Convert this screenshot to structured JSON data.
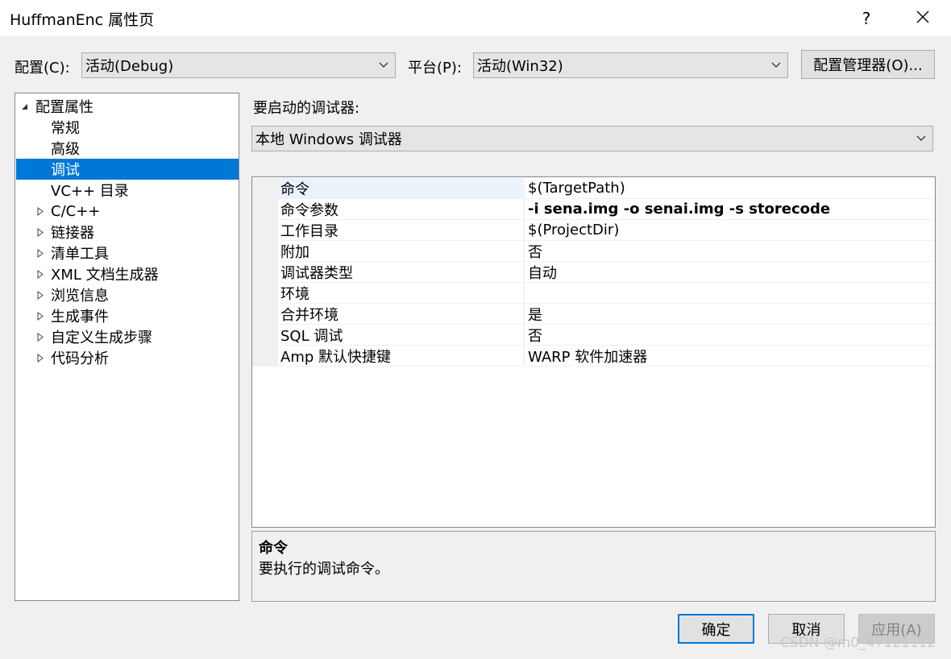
{
  "window": {
    "title": "HuffmanEnc 属性页",
    "help_label": "?",
    "close_label": "✕"
  },
  "config_bar": {
    "config_label": "配置(C):",
    "config_value": "活动(Debug)",
    "platform_label": "平台(P):",
    "platform_value": "活动(Win32)",
    "manager_button": "配置管理器(O)..."
  },
  "tree": {
    "root": "配置属性",
    "items": [
      {
        "label": "常规",
        "expandable": false
      },
      {
        "label": "高级",
        "expandable": false
      },
      {
        "label": "调试",
        "expandable": false,
        "selected": true
      },
      {
        "label": "VC++ 目录",
        "expandable": false
      },
      {
        "label": "C/C++",
        "expandable": true
      },
      {
        "label": "链接器",
        "expandable": true
      },
      {
        "label": "清单工具",
        "expandable": true
      },
      {
        "label": "XML 文档生成器",
        "expandable": true
      },
      {
        "label": "浏览信息",
        "expandable": true
      },
      {
        "label": "生成事件",
        "expandable": true
      },
      {
        "label": "自定义生成步骤",
        "expandable": true
      },
      {
        "label": "代码分析",
        "expandable": true
      }
    ]
  },
  "debugger": {
    "label": "要启动的调试器:",
    "value": "本地 Windows 调试器"
  },
  "properties": [
    {
      "name": "命令",
      "value": "$(TargetPath)",
      "bold": false
    },
    {
      "name": "命令参数",
      "value": "-i sena.img -o senai.img -s storecode",
      "bold": true
    },
    {
      "name": "工作目录",
      "value": "$(ProjectDir)",
      "bold": false
    },
    {
      "name": "附加",
      "value": "否",
      "bold": false
    },
    {
      "name": "调试器类型",
      "value": "自动",
      "bold": false
    },
    {
      "name": "环境",
      "value": "",
      "bold": false
    },
    {
      "name": "合并环境",
      "value": "是",
      "bold": false
    },
    {
      "name": "SQL 调试",
      "value": "否",
      "bold": false
    },
    {
      "name": "Amp 默认快捷键",
      "value": "WARP 软件加速器",
      "bold": false
    }
  ],
  "description": {
    "title": "命令",
    "text": "要执行的调试命令。"
  },
  "buttons": {
    "ok": "确定",
    "cancel": "取消",
    "apply": "应用(A)"
  },
  "watermark": "CSDN @m0_47121112",
  "colors": {
    "selection": "#0078d7",
    "dialog_bg": "#f0f0f0"
  }
}
